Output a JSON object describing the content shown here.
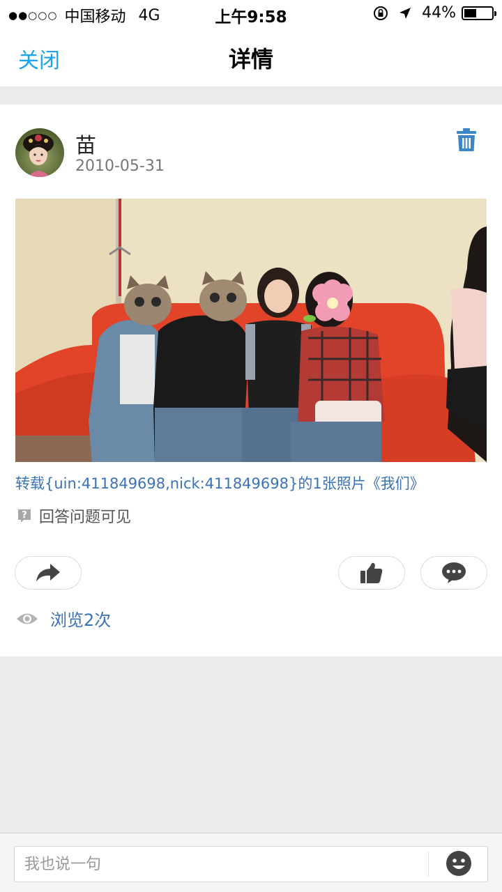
{
  "status_bar": {
    "signal_dots": "●●○○○",
    "carrier": "中国移动",
    "network": "4G",
    "time": "上午9:58",
    "battery_text": "44%",
    "battery_level": 0.44
  },
  "nav": {
    "close_label": "关闭",
    "title": "详情"
  },
  "post": {
    "author": "苗",
    "date": "2010-05-31",
    "caption": "转载{uin:411849698,nick:411849698}的1张照片《我们》",
    "visibility_text": "回答问题可见",
    "views_text": "浏览2次"
  },
  "comment_box": {
    "placeholder": "我也说一句"
  },
  "icons": {
    "close": "text-link",
    "delete": "trash-icon",
    "share": "share-arrow-icon",
    "like": "thumbs-up-icon",
    "comment": "speech-bubble-icon",
    "views": "eye-icon",
    "emoji": "smiley-icon",
    "visibility": "question-badge-icon"
  },
  "colors": {
    "accent_blue": "#1aa3e8",
    "link_blue": "#3a72b8",
    "icon_blue": "#3d86c6",
    "icon_dark": "#444444",
    "background": "#ebebeb"
  }
}
